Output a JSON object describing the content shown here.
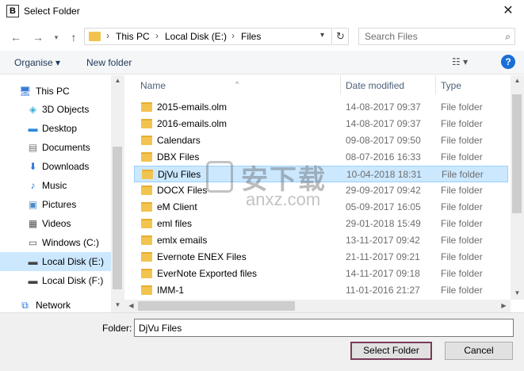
{
  "window": {
    "app_icon_letter": "B",
    "title": "Select Folder",
    "close_glyph": "✕"
  },
  "nav": {
    "back_icon": "arrow-left-icon",
    "forward_icon": "arrow-right-icon",
    "recent_icon": "chevron-down-icon",
    "up_icon": "arrow-up-icon",
    "breadcrumb": [
      "This PC",
      "Local Disk (E:)",
      "Files"
    ],
    "search_placeholder": "Search Files"
  },
  "toolbar": {
    "organise": "Organise ▾",
    "new_folder": "New folder"
  },
  "sidebar": {
    "items": [
      {
        "label": "This PC",
        "icon": "pc-icon",
        "glyph": "🖥"
      },
      {
        "label": "3D Objects",
        "icon": "cube-icon",
        "glyph": "◈"
      },
      {
        "label": "Desktop",
        "icon": "desktop-icon",
        "glyph": "▬"
      },
      {
        "label": "Documents",
        "icon": "documents-icon",
        "glyph": "▤"
      },
      {
        "label": "Downloads",
        "icon": "download-icon",
        "glyph": "⬇"
      },
      {
        "label": "Music",
        "icon": "music-icon",
        "glyph": "♪"
      },
      {
        "label": "Pictures",
        "icon": "pictures-icon",
        "glyph": "▣"
      },
      {
        "label": "Videos",
        "icon": "videos-icon",
        "glyph": "▦"
      },
      {
        "label": "Windows (C:)",
        "icon": "drive-icon",
        "glyph": "▭"
      },
      {
        "label": "Local Disk (E:)",
        "icon": "drive-icon",
        "glyph": "▬"
      },
      {
        "label": "Local Disk (F:)",
        "icon": "drive-icon",
        "glyph": "▬"
      },
      {
        "label": "Network",
        "icon": "network-icon",
        "glyph": "⧉"
      }
    ],
    "selected": "Local Disk (E:)"
  },
  "columns": {
    "name": "Name",
    "date": "Date modified",
    "type": "Type"
  },
  "files": [
    {
      "name": "2015-emails.olm",
      "date": "14-08-2017 09:37",
      "type": "File folder"
    },
    {
      "name": "2016-emails.olm",
      "date": "14-08-2017 09:37",
      "type": "File folder"
    },
    {
      "name": "Calendars",
      "date": "09-08-2017 09:50",
      "type": "File folder"
    },
    {
      "name": "DBX Files",
      "date": "08-07-2016 16:33",
      "type": "File folder"
    },
    {
      "name": "DjVu Files",
      "date": "10-04-2018 18:31",
      "type": "File folder"
    },
    {
      "name": "DOCX Files",
      "date": "29-09-2017 09:42",
      "type": "File folder"
    },
    {
      "name": "eM Client",
      "date": "05-09-2017 16:05",
      "type": "File folder"
    },
    {
      "name": "eml files",
      "date": "29-01-2018 15:49",
      "type": "File folder"
    },
    {
      "name": "emlx emails",
      "date": "13-11-2017 09:42",
      "type": "File folder"
    },
    {
      "name": "Evernote ENEX Files",
      "date": "21-11-2017 09:21",
      "type": "File folder"
    },
    {
      "name": "EverNote Exported files",
      "date": "14-11-2017 09:18",
      "type": "File folder"
    },
    {
      "name": "IMM-1",
      "date": "11-01-2016 21:27",
      "type": "File folder"
    }
  ],
  "selected_file": "DjVu Files",
  "watermark": {
    "text": "安下载",
    "sub": "anxz.com"
  },
  "bottom": {
    "folder_label": "Folder:",
    "folder_value": "DjVu Files",
    "select_button": "Select Folder",
    "cancel_button": "Cancel"
  },
  "colors": {
    "selection": "#cce8ff",
    "folder": "#f2c44f",
    "help": "#1a6ed8"
  }
}
